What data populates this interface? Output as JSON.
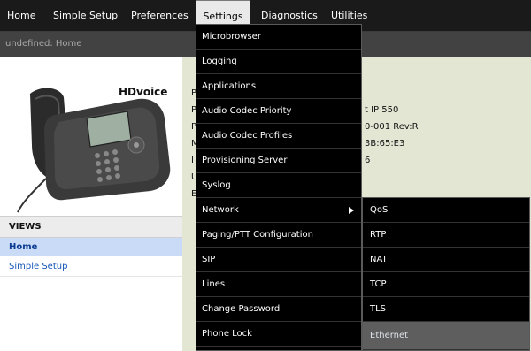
{
  "topnav": {
    "items": [
      {
        "label": "Home"
      },
      {
        "label": "Simple Setup"
      },
      {
        "label": "Preferences"
      },
      {
        "label": "Settings"
      },
      {
        "label": "Diagnostics"
      },
      {
        "label": "Utilities"
      }
    ]
  },
  "breadcrumb": "undefined: Home",
  "phone_brand": "HDvoice",
  "views": {
    "header": "VIEWS",
    "items": [
      {
        "label": "Home"
      },
      {
        "label": "Simple Setup"
      }
    ]
  },
  "info": {
    "rows": [
      {
        "prefix": "P",
        "value": ""
      },
      {
        "prefix": "P",
        "value": "t IP 550"
      },
      {
        "prefix": "P",
        "value": "0-001 Rev:R"
      },
      {
        "prefix": "M",
        "value": "3B:65:E3"
      },
      {
        "prefix": "I",
        "value": "6"
      },
      {
        "prefix": "U",
        "value": ""
      },
      {
        "prefix": "E",
        "value": ""
      }
    ]
  },
  "settings_menu": {
    "items": [
      {
        "label": "Microbrowser"
      },
      {
        "label": "Logging"
      },
      {
        "label": "Applications"
      },
      {
        "label": "Audio Codec Priority"
      },
      {
        "label": "Audio Codec Profiles"
      },
      {
        "label": "Provisioning Server"
      },
      {
        "label": "Syslog"
      },
      {
        "label": "Network"
      },
      {
        "label": "Paging/PTT Configuration"
      },
      {
        "label": "SIP"
      },
      {
        "label": "Lines"
      },
      {
        "label": "Change Password"
      },
      {
        "label": "Phone Lock"
      }
    ]
  },
  "network_submenu": {
    "items": [
      {
        "label": "QoS"
      },
      {
        "label": "RTP"
      },
      {
        "label": "NAT"
      },
      {
        "label": "TCP"
      },
      {
        "label": "TLS"
      },
      {
        "label": "Ethernet"
      }
    ]
  }
}
